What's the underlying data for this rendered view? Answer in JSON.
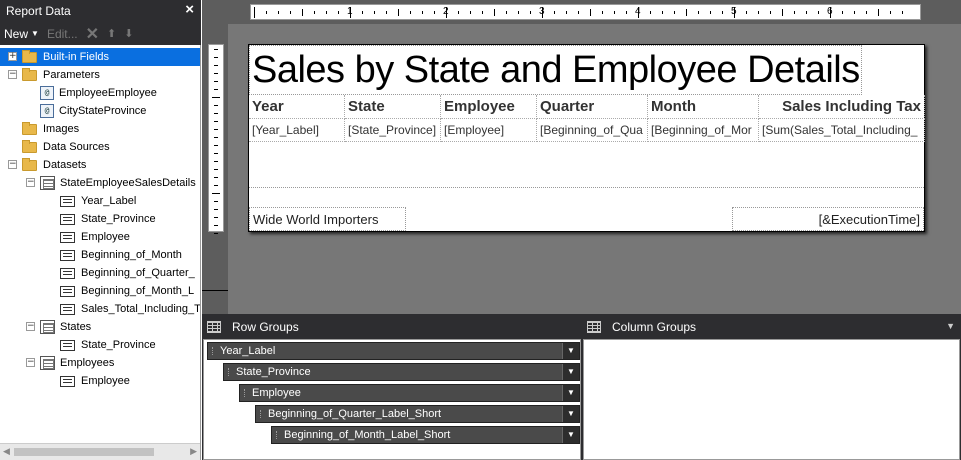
{
  "report_data": {
    "title": "Report Data",
    "close_icon": "close-icon",
    "toolbar": {
      "new_label": "New",
      "edit_label": "Edit...",
      "delete_icon": "delete-icon",
      "up_icon": "move-up-icon",
      "down_icon": "move-down-icon"
    },
    "tree": {
      "built_in_fields": "Built-in Fields",
      "parameters": "Parameters",
      "param_1": "EmployeeEmployee",
      "param_2": "CityStateProvince",
      "images": "Images",
      "data_sources": "Data Sources",
      "datasets": "Datasets",
      "ds_1": "StateEmployeeSalesDetails",
      "ds_1_fields": [
        "Year_Label",
        "State_Province",
        "Employee",
        "Beginning_of_Month",
        "Beginning_of_Quarter_",
        "Beginning_of_Month_L",
        "Sales_Total_Including_T"
      ],
      "ds_2": "States",
      "ds_2_fields": [
        "State_Province"
      ],
      "ds_3": "Employees",
      "ds_3_fields": [
        "Employee"
      ]
    }
  },
  "ruler": {
    "marks": [
      "1",
      "2",
      "3",
      "4",
      "5",
      "6"
    ]
  },
  "report": {
    "title": "Sales by State and Employee Details",
    "headers": [
      "Year",
      "State",
      "Employee",
      "Quarter",
      "Month",
      "Sales Including Tax"
    ],
    "details": [
      "[Year_Label]",
      "[State_Province]",
      "[Employee]",
      "[Beginning_of_Qua",
      "[Beginning_of_Mor",
      "[Sum(Sales_Total_Including_"
    ],
    "footer_left": "Wide World Importers",
    "footer_right": "[&ExecutionTime]"
  },
  "groups": {
    "row_title": "Row Groups",
    "column_title": "Column Groups",
    "row_groups": [
      "Year_Label",
      "State_Province",
      "Employee",
      "Beginning_of_Quarter_Label_Short",
      "Beginning_of_Month_Label_Short"
    ]
  }
}
